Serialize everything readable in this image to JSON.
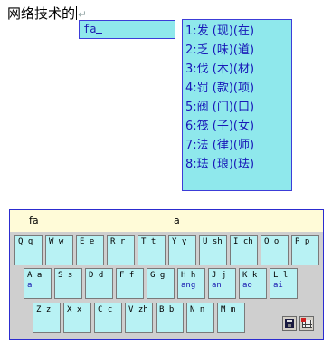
{
  "document": {
    "text": "网络技术的"
  },
  "composition": {
    "text": "fa"
  },
  "candidates": [
    "1:发 (现)(在)",
    "2:乏 (味)(道)",
    "3:伐 (木)(材)",
    "4:罚 (款)(项)",
    "5:阀 (门)(口)",
    "6:筏 (子)(女)",
    "7:法 (律)(师)",
    "8:珐 (琅)(珐)"
  ],
  "keyboard": {
    "code_display": "fa",
    "hint_display": "a",
    "rows": [
      [
        {
          "label": "Q q",
          "sub": ""
        },
        {
          "label": "W w",
          "sub": ""
        },
        {
          "label": "E e",
          "sub": ""
        },
        {
          "label": "R r",
          "sub": ""
        },
        {
          "label": "T t",
          "sub": ""
        },
        {
          "label": "Y y",
          "sub": ""
        },
        {
          "label": "U sh",
          "sub": ""
        },
        {
          "label": "I ch",
          "sub": ""
        },
        {
          "label": "O o",
          "sub": ""
        },
        {
          "label": "P p",
          "sub": ""
        }
      ],
      [
        {
          "label": "A a",
          "sub": "a"
        },
        {
          "label": "S s",
          "sub": ""
        },
        {
          "label": "D d",
          "sub": ""
        },
        {
          "label": "F f",
          "sub": ""
        },
        {
          "label": "G g",
          "sub": ""
        },
        {
          "label": "H h",
          "sub": "ang"
        },
        {
          "label": "J j",
          "sub": "an"
        },
        {
          "label": "K k",
          "sub": "ao"
        },
        {
          "label": "L l",
          "sub": "ai"
        }
      ],
      [
        {
          "label": "Z z",
          "sub": ""
        },
        {
          "label": "X x",
          "sub": ""
        },
        {
          "label": "C c",
          "sub": ""
        },
        {
          "label": "V zh",
          "sub": ""
        },
        {
          "label": "B b",
          "sub": ""
        },
        {
          "label": "N n",
          "sub": ""
        },
        {
          "label": "M m",
          "sub": ""
        }
      ]
    ],
    "icons": [
      "floppy-icon",
      "soft-keyboard-icon"
    ]
  }
}
